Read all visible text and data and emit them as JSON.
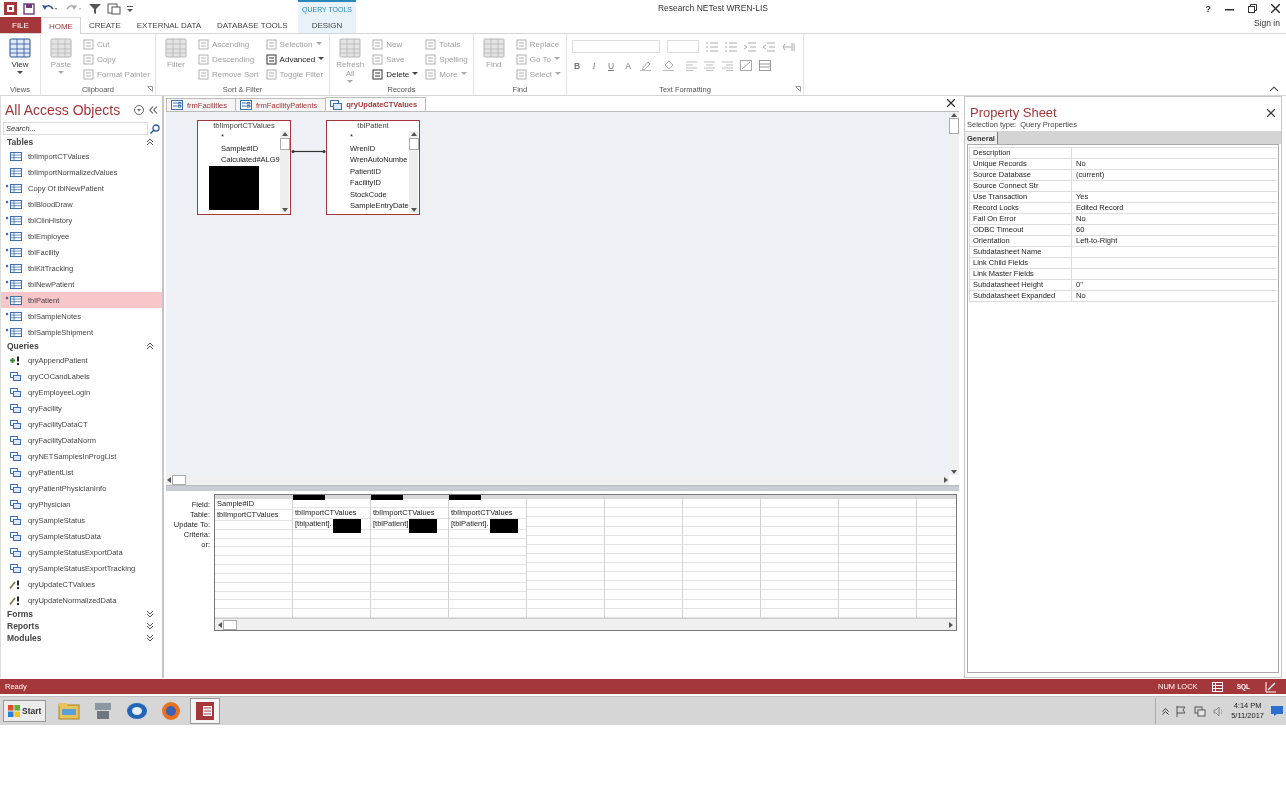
{
  "title_bar": {
    "title": "Research NETest WREN-LIS",
    "help": "?",
    "sign_in": "Sign in",
    "context_header": "QUERY TOOLS"
  },
  "ribbon_tabs": [
    {
      "label": "FILE",
      "kind": "file",
      "selected": false
    },
    {
      "label": "HOME",
      "kind": "tab",
      "selected": true
    },
    {
      "label": "CREATE",
      "kind": "tab",
      "selected": false
    },
    {
      "label": "EXTERNAL DATA",
      "kind": "tab",
      "selected": false
    },
    {
      "label": "DATABASE TOOLS",
      "kind": "tab",
      "selected": false
    },
    {
      "label": "DESIGN",
      "kind": "context",
      "selected": false
    }
  ],
  "ribbon": {
    "groups": [
      {
        "label": "Views",
        "kind": "commands",
        "launcher": false,
        "large": [
          {
            "label": "View",
            "disabled": false,
            "menu": true
          }
        ]
      },
      {
        "label": "Clipboard",
        "kind": "commands",
        "launcher": true,
        "large": [
          {
            "label": "Paste",
            "disabled": true,
            "menu": true
          }
        ],
        "columns": [
          [
            {
              "label": "Cut",
              "disabled": true,
              "menu": false
            },
            {
              "label": "Copy",
              "disabled": true,
              "menu": false
            },
            {
              "label": "Format Painter",
              "disabled": true,
              "menu": false
            }
          ]
        ]
      },
      {
        "label": "Sort & Filter",
        "kind": "commands",
        "launcher": false,
        "large": [
          {
            "label": "Filter",
            "disabled": true,
            "menu": false
          }
        ],
        "columns": [
          [
            {
              "label": "Ascending",
              "disabled": true,
              "menu": false
            },
            {
              "label": "Descending",
              "disabled": true,
              "menu": false
            },
            {
              "label": "Remove Sort",
              "disabled": true,
              "menu": false
            }
          ],
          [
            {
              "label": "Selection",
              "disabled": true,
              "menu": true
            },
            {
              "label": "Advanced",
              "disabled": false,
              "menu": true
            },
            {
              "label": "Toggle Filter",
              "disabled": true,
              "menu": false
            }
          ]
        ]
      },
      {
        "label": "Records",
        "kind": "commands",
        "launcher": false,
        "large": [
          {
            "label": "Refresh All",
            "disabled": true,
            "menu": true
          }
        ],
        "columns": [
          [
            {
              "label": "New",
              "disabled": true,
              "menu": false
            },
            {
              "label": "Save",
              "disabled": true,
              "menu": false
            },
            {
              "label": "Delete",
              "disabled": false,
              "menu": true
            }
          ],
          [
            {
              "label": "Totals",
              "disabled": true,
              "menu": false
            },
            {
              "label": "Spelling",
              "disabled": true,
              "menu": false
            },
            {
              "label": "More",
              "disabled": true,
              "menu": true
            }
          ]
        ]
      },
      {
        "label": "Find",
        "kind": "commands",
        "launcher": false,
        "large": [
          {
            "label": "Find",
            "disabled": true,
            "menu": false
          }
        ],
        "columns": [
          [
            {
              "label": "Replace",
              "disabled": true,
              "menu": false
            },
            {
              "label": "Go To",
              "disabled": true,
              "menu": true
            },
            {
              "label": "Select",
              "disabled": true,
              "menu": true
            }
          ]
        ]
      },
      {
        "label": "Text Formatting",
        "kind": "formatting",
        "launcher": true,
        "letters": [
          "B",
          "I",
          "U",
          "A"
        ]
      }
    ]
  },
  "navigation": {
    "title": "All Access Objects",
    "search": {
      "placeholder": "Search..."
    },
    "groups": [
      {
        "label": "Tables",
        "expanded": true,
        "items": [
          {
            "label": "tblImportCTValues",
            "kind": "table",
            "linked": false,
            "selected": false
          },
          {
            "label": "tblImportNormalizedValues",
            "kind": "table",
            "linked": false,
            "selected": false
          },
          {
            "label": "Copy Of tblNewPatient",
            "kind": "table",
            "linked": true,
            "selected": false
          },
          {
            "label": "tblBloodDraw",
            "kind": "table",
            "linked": true,
            "selected": false
          },
          {
            "label": "tblClinHistory",
            "kind": "table",
            "linked": true,
            "selected": false
          },
          {
            "label": "tblEmployee",
            "kind": "table",
            "linked": true,
            "selected": false
          },
          {
            "label": "tblFacility",
            "kind": "table",
            "linked": true,
            "selected": false
          },
          {
            "label": "tblKitTracking",
            "kind": "table",
            "linked": true,
            "selected": false
          },
          {
            "label": "tblNewPatient",
            "kind": "table",
            "linked": true,
            "selected": false
          },
          {
            "label": "tblPatient",
            "kind": "table",
            "linked": true,
            "selected": true
          },
          {
            "label": "tblSampleNotes",
            "kind": "table",
            "linked": true,
            "selected": false
          },
          {
            "label": "tblSampleShipment",
            "kind": "table",
            "linked": true,
            "selected": false
          }
        ]
      },
      {
        "label": "Queries",
        "expanded": true,
        "items": [
          {
            "label": "qryAppendPatient",
            "kind": "append",
            "linked": false,
            "selected": false
          },
          {
            "label": "qryCOCandLabels",
            "kind": "select",
            "linked": false,
            "selected": false
          },
          {
            "label": "qryEmployeeLogin",
            "kind": "select",
            "linked": false,
            "selected": false
          },
          {
            "label": "qryFacility",
            "kind": "select",
            "linked": false,
            "selected": false
          },
          {
            "label": "qryFacilityDataCT",
            "kind": "select",
            "linked": false,
            "selected": false
          },
          {
            "label": "qryFacilityDataNorm",
            "kind": "select",
            "linked": false,
            "selected": false
          },
          {
            "label": "qryNETSamplesInProgList",
            "kind": "select",
            "linked": false,
            "selected": false
          },
          {
            "label": "qryPatientList",
            "kind": "select",
            "linked": false,
            "selected": false
          },
          {
            "label": "qryPatientPhysicianInfo",
            "kind": "select",
            "linked": false,
            "selected": false
          },
          {
            "label": "qryPhysician",
            "kind": "select",
            "linked": false,
            "selected": false
          },
          {
            "label": "qrySampleStatus",
            "kind": "select",
            "linked": false,
            "selected": false
          },
          {
            "label": "qrySampleStatusData",
            "kind": "select",
            "linked": false,
            "selected": false
          },
          {
            "label": "qrySampleStatusExportData",
            "kind": "select",
            "linked": false,
            "selected": false
          },
          {
            "label": "qrySampleStatusExportTracking",
            "kind": "select",
            "linked": false,
            "selected": false
          },
          {
            "label": "qryUpdateCTValues",
            "kind": "update",
            "linked": false,
            "selected": false
          },
          {
            "label": "qryUpdateNormalizedData",
            "kind": "update",
            "linked": false,
            "selected": false
          }
        ]
      },
      {
        "label": "Forms",
        "expanded": false
      },
      {
        "label": "Reports",
        "expanded": false
      },
      {
        "label": "Modules",
        "expanded": false
      }
    ]
  },
  "document_tabs": [
    {
      "label": "frmFacilities",
      "kind": "form",
      "selected": false
    },
    {
      "label": "frmFacilityPatients",
      "kind": "form",
      "selected": false
    },
    {
      "label": "qryUpdateCTValues",
      "kind": "query",
      "selected": true
    }
  ],
  "design_tables": [
    {
      "title": "tblImportCTValues",
      "fields": [
        "*",
        "Sample#ID",
        "Calculated#ALG9"
      ],
      "redacted": true
    },
    {
      "title": "tblPatient",
      "fields": [
        "*",
        "WrenID",
        "WrenAutoNumbe",
        "PatientID",
        "FacilityID",
        "StockCode",
        "SampleEntryDate"
      ],
      "redacted": false
    }
  ],
  "grid": {
    "row_labels": [
      "Field:",
      "Table:",
      "Update To:",
      "Criteria:",
      "or:"
    ],
    "columns": [
      {
        "field": "Sample#ID",
        "field_redacted": false,
        "table": "tblImportCTValues",
        "update_redacted": false
      },
      {
        "field_redacted": true,
        "table": "tblImportCTValues",
        "update_to": "[tblpatient].",
        "update_redacted": true
      },
      {
        "field_redacted": true,
        "table": "tblImportCTValues",
        "update_to": "[tblPatient]",
        "update_redacted": true
      },
      {
        "field_redacted": true,
        "table": "tblImportCTValues",
        "update_to": "[tblPatient].",
        "update_redacted": true
      }
    ]
  },
  "property_sheet": {
    "title": "Property Sheet",
    "selection_label": "Selection type:",
    "selection_value": "Query Properties",
    "tabs": [
      {
        "label": "General",
        "selected": true
      }
    ],
    "rows": [
      {
        "name": "Description"
      },
      {
        "name": "Unique Records",
        "value": "No"
      },
      {
        "name": "Source Database",
        "value": "(current)"
      },
      {
        "name": "Source Connect Str"
      },
      {
        "name": "Use Transaction",
        "value": "Yes"
      },
      {
        "name": "Record Locks",
        "value": "Edited Record"
      },
      {
        "name": "Fail On Error",
        "value": "No"
      },
      {
        "name": "ODBC Timeout",
        "value": "60"
      },
      {
        "name": "Orientation",
        "value": "Left-to-Right"
      },
      {
        "name": "Subdatasheet Name"
      },
      {
        "name": "Link Child Fields"
      },
      {
        "name": "Link Master Fields"
      },
      {
        "name": "Subdatasheet Height",
        "value": "0\""
      },
      {
        "name": "Subdatasheet Expanded",
        "value": "No"
      }
    ]
  },
  "status_bar": {
    "message": "Ready",
    "indicator": "NUM LOCK",
    "sql_view": "SQL"
  },
  "taskbar": {
    "start": "Start",
    "apps": [
      {
        "selected": false
      },
      {
        "selected": false
      },
      {
        "selected": false
      },
      {
        "selected": false
      },
      {
        "selected": true
      }
    ],
    "time": "4:14 PM",
    "date": "5/11/2017"
  }
}
